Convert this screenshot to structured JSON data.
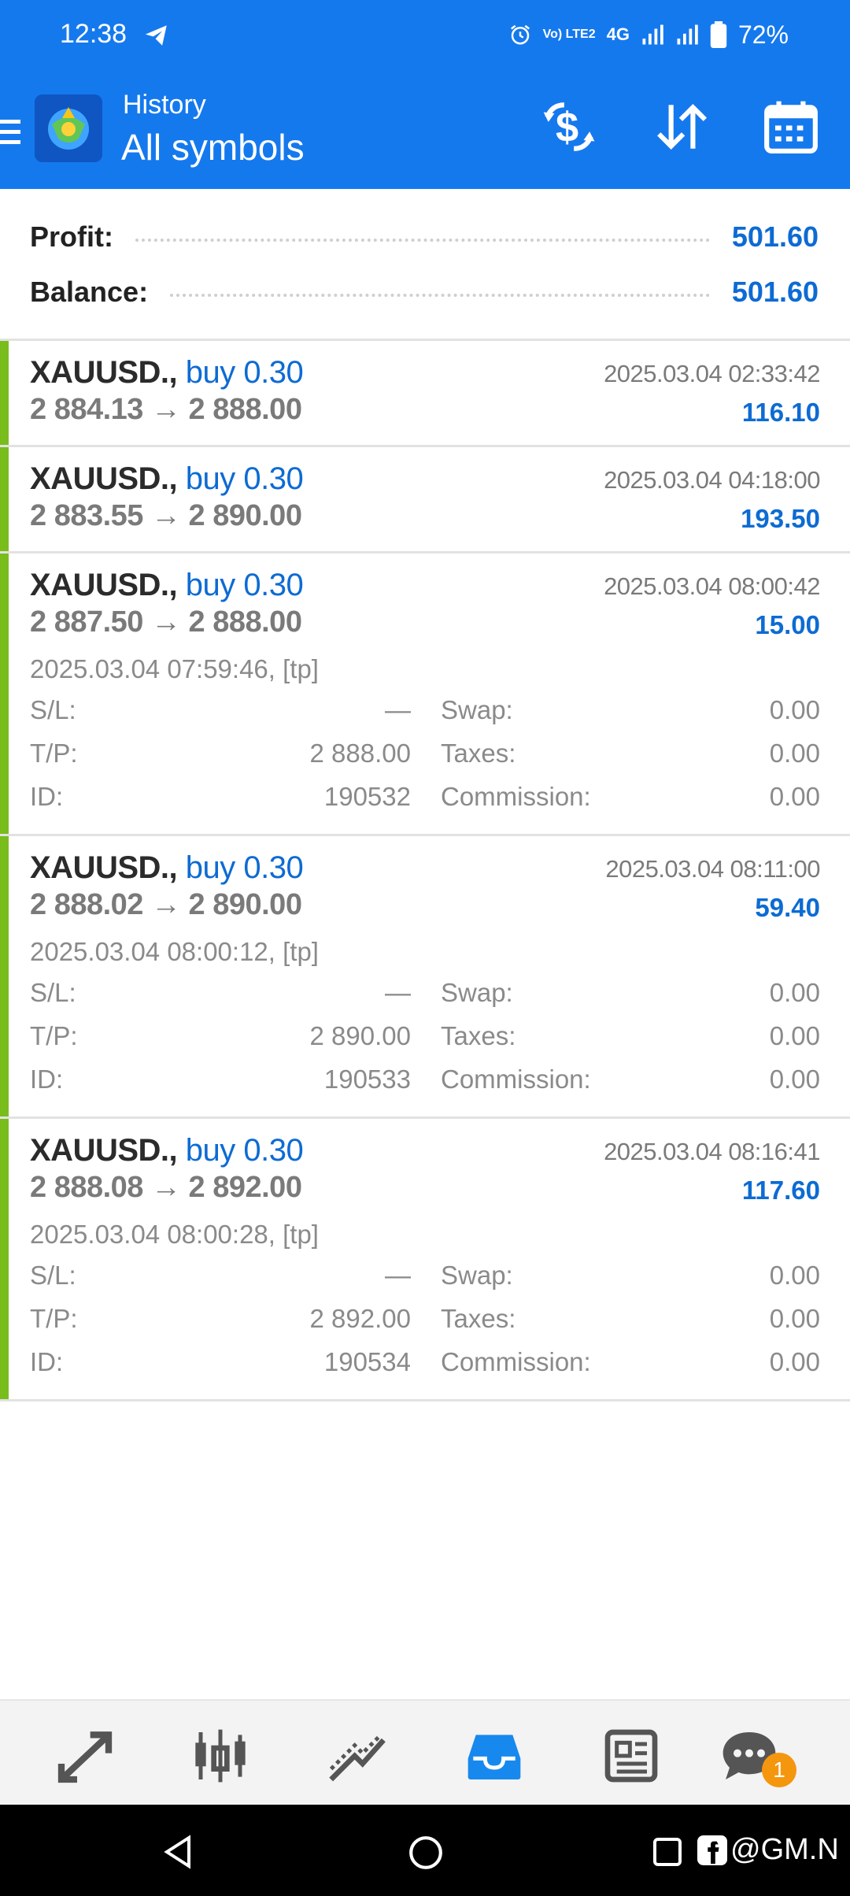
{
  "status_bar": {
    "time": "12:38",
    "network": "4G",
    "volte": "Vo) LTE2",
    "battery": "72%"
  },
  "header": {
    "subtitle": "History",
    "title": "All symbols",
    "icons": [
      "dollar-sync-icon",
      "sort-icon",
      "calendar-icon"
    ]
  },
  "summary": {
    "profit_label": "Profit:",
    "profit_value": "501.60",
    "balance_label": "Balance:",
    "balance_value": "501.60"
  },
  "deals": [
    {
      "symbol": "XAUUSD.,",
      "side": "buy 0.30",
      "prices": "2 884.13 → 2 888.00",
      "time": "2025.03.04 02:33:42",
      "profit": "116.10"
    },
    {
      "symbol": "XAUUSD.,",
      "side": "buy 0.30",
      "prices": "2 883.55 → 2 890.00",
      "time": "2025.03.04 04:18:00",
      "profit": "193.50"
    },
    {
      "symbol": "XAUUSD.,",
      "side": "buy 0.30",
      "prices": "2 887.50 → 2 888.00",
      "time": "2025.03.04 08:00:42",
      "profit": "15.00",
      "open_info": "2025.03.04 07:59:46, [tp]",
      "sl_label": "S/L:",
      "sl": "—",
      "tp_label": "T/P:",
      "tp": "2 888.00",
      "id_label": "ID:",
      "id": "190532",
      "swap_label": "Swap:",
      "swap": "0.00",
      "taxes_label": "Taxes:",
      "taxes": "0.00",
      "commission_label": "Commission:",
      "commission": "0.00"
    },
    {
      "symbol": "XAUUSD.,",
      "side": "buy 0.30",
      "prices": "2 888.02 → 2 890.00",
      "time": "2025.03.04 08:11:00",
      "profit": "59.40",
      "open_info": "2025.03.04 08:00:12, [tp]",
      "sl_label": "S/L:",
      "sl": "—",
      "tp_label": "T/P:",
      "tp": "2 890.00",
      "id_label": "ID:",
      "id": "190533",
      "swap_label": "Swap:",
      "swap": "0.00",
      "taxes_label": "Taxes:",
      "taxes": "0.00",
      "commission_label": "Commission:",
      "commission": "0.00"
    },
    {
      "symbol": "XAUUSD.,",
      "side": "buy 0.30",
      "prices": "2 888.08 → 2 892.00",
      "time": "2025.03.04 08:16:41",
      "profit": "117.60",
      "open_info": "2025.03.04 08:00:28, [tp]",
      "sl_label": "S/L:",
      "sl": "—",
      "tp_label": "T/P:",
      "tp": "2 892.00",
      "id_label": "ID:",
      "id": "190534",
      "swap_label": "Swap:",
      "swap": "0.00",
      "taxes_label": "Taxes:",
      "taxes": "0.00",
      "commission_label": "Commission:",
      "commission": "0.00"
    }
  ],
  "bottom_nav": {
    "items": [
      "quotes-icon",
      "chart-icon",
      "trade-icon",
      "history-icon",
      "news-icon",
      "messages-icon"
    ],
    "active": "history-icon",
    "messages_badge": "1"
  },
  "watermark": "@GM.N",
  "colors": {
    "primary": "#1579ee",
    "accent_text": "#0d6bd3",
    "buy_bar": "#79bd1d",
    "badge": "#f5960f"
  }
}
